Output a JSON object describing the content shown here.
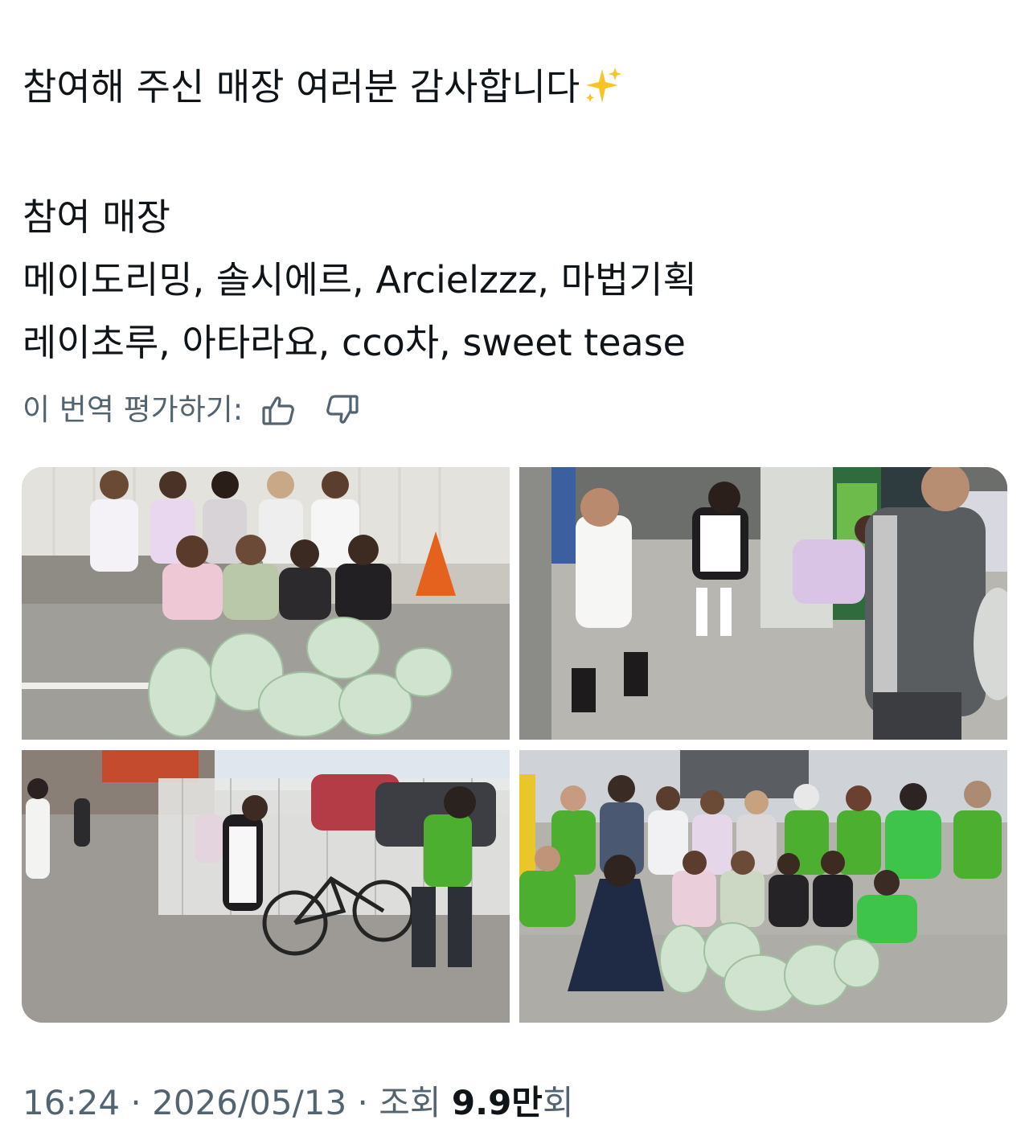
{
  "post": {
    "line1": "참여해 주신 매장 여러분 감사합니다",
    "line1_emoji": "sparkles-emoji",
    "line2": "참여 매장",
    "line3": "메이도리밍, 솔시에르, Arcielzzz, 마법기획",
    "line4": "레이초루, 아타라요, cco차, sweet tease"
  },
  "translation_rating": {
    "label": "이 번역 평가하기:",
    "up_icon": "thumbs-up-icon",
    "down_icon": "thumbs-down-icon"
  },
  "media": {
    "count": 4,
    "photos": [
      {
        "subject": "group of women in maid costumes sitting with trash bags"
      },
      {
        "subject": "volunteers picking up litter on a street"
      },
      {
        "subject": "volunteers cleaning along a fence with bicycles"
      },
      {
        "subject": "large group photo with volunteers and trash bags"
      }
    ]
  },
  "footer": {
    "time": "16:24",
    "sep1": " · ",
    "date": "2026/05/13",
    "sep2": " · ",
    "views_label": "조회 ",
    "views_count": "9.9",
    "views_unit": "만",
    "views_suffix": "회"
  },
  "colors": {
    "text_primary": "#0f1419",
    "text_secondary": "#536471",
    "background": "#ffffff",
    "vest_green": "#4caf2f"
  }
}
